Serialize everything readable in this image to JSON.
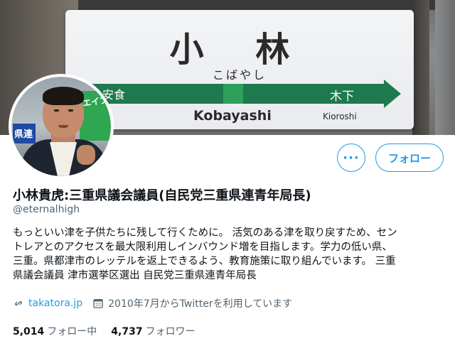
{
  "banner": {
    "kanji": "小 林",
    "kana": "こばやし",
    "prev_station": "安食",
    "next_station": "木下",
    "romaji": "Kobayashi",
    "next_romaji": "Kioroshi"
  },
  "avatar": {
    "shop_text": "エイブ",
    "sign_text": "県連"
  },
  "actions": {
    "more_label": "···",
    "follow_label": "フォロー"
  },
  "profile": {
    "name": "小林貴虎:三重県議会議員(自民党三重県連青年局長)",
    "handle": "@eternalhigh",
    "bio_lines": [
      "もっといい津を子供たちに残して行くために。 活気のある津を取り戻すため、セン",
      "トレアとのアクセスを最大限利用しインバウンド増を目指します。学力の低い県、",
      "三重。県都津市のレッテルを返上できるよう、教育施策に取り組んでいます。 三重",
      "県議会議員 津市選挙区選出 自民党三重県連青年局長"
    ],
    "website": "takatora.jp",
    "joined": "2010年7月からTwitterを利用しています"
  },
  "stats": {
    "following_count": "5,014",
    "following_label": "フォロー中",
    "followers_count": "4,737",
    "followers_label": "フォロワー"
  },
  "colors": {
    "accent": "#1d9bf0",
    "text_primary": "#0f1419",
    "text_secondary": "#536471",
    "sign_green": "#1e7a4e"
  },
  "icons": {
    "link": "link-icon",
    "calendar": "calendar-icon",
    "more": "more-icon"
  }
}
